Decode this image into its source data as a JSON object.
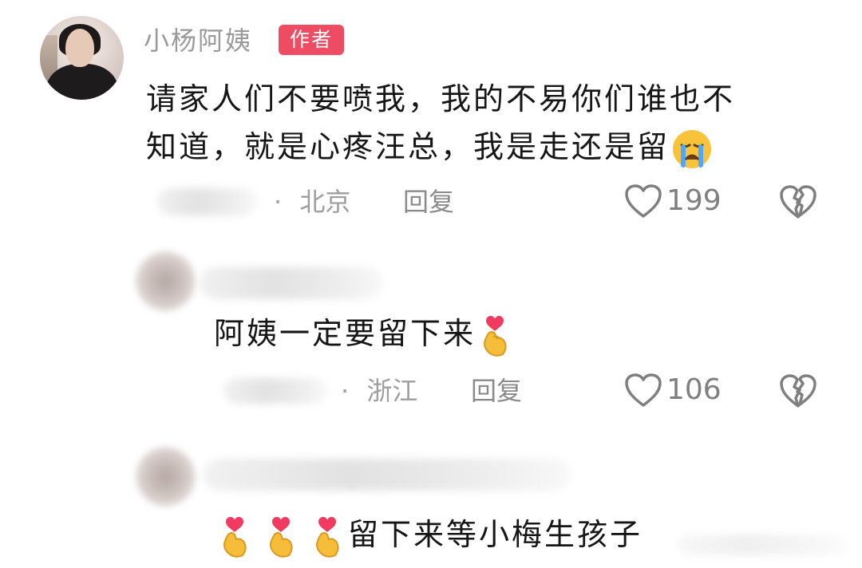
{
  "author": {
    "name": "小杨阿姨",
    "tag": "作者"
  },
  "comments": [
    {
      "author_blurred": true,
      "text_line1": "请家人们不要喷我，我的不易你们谁也不",
      "text_line2": "知道，就是心疼汪总，我是走还是留",
      "emoji": "crying-face",
      "separator": "·",
      "location": "北京",
      "reply_label": "回复",
      "like_count": "199"
    },
    {
      "author_blurred": true,
      "text": "阿姨一定要留下来",
      "emoji": "heart-hand",
      "separator": "·",
      "location": "浙江",
      "reply_label": "回复",
      "like_count": "106"
    },
    {
      "author_blurred": true,
      "text": "留下来等小梅生孩子",
      "emoji": "heart-hand-x3"
    }
  ],
  "colors": {
    "author_tag_bg": "#ee4c63",
    "meta_gray": "#9e9e9e"
  }
}
